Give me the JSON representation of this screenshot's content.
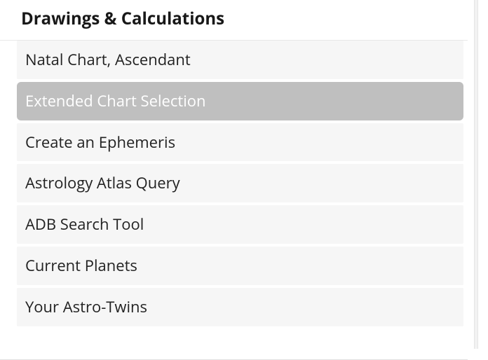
{
  "section": {
    "title": "Drawings & Calculations",
    "items": [
      {
        "label": "Natal Chart, Ascendant",
        "selected": false
      },
      {
        "label": "Extended Chart Selection",
        "selected": true
      },
      {
        "label": "Create an Ephemeris",
        "selected": false
      },
      {
        "label": "Astrology Atlas Query",
        "selected": false
      },
      {
        "label": "ADB Search Tool",
        "selected": false
      },
      {
        "label": "Current Planets",
        "selected": false
      },
      {
        "label": "Your Astro-Twins",
        "selected": false
      }
    ]
  }
}
